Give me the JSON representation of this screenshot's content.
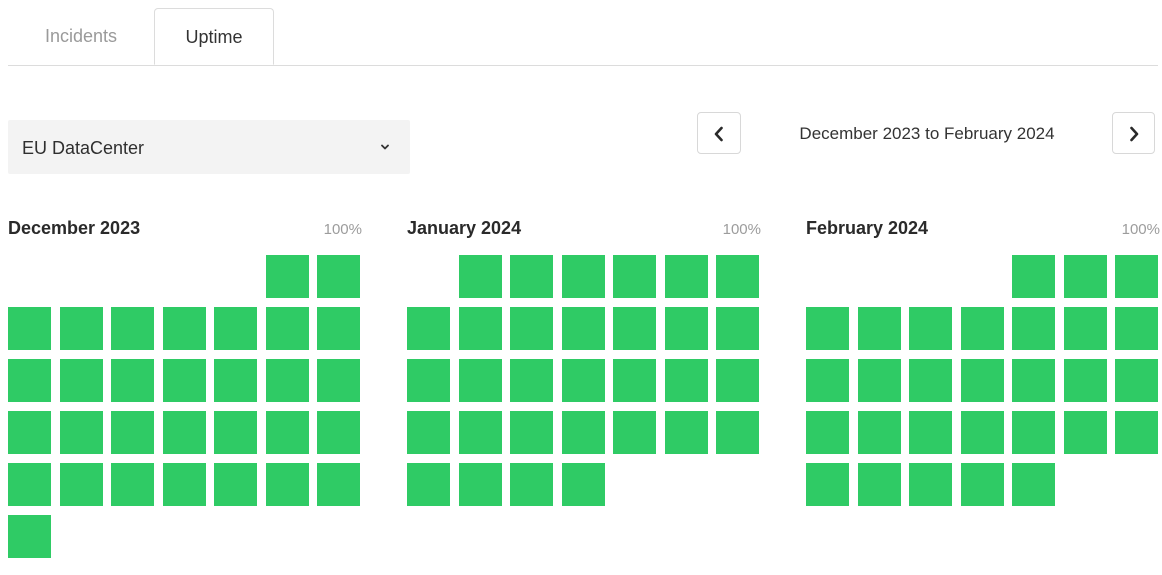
{
  "tabs": {
    "incidents": "Incidents",
    "uptime": "Uptime"
  },
  "region": {
    "selected": "EU DataCenter"
  },
  "range": {
    "label": "December 2023 to February 2024"
  },
  "colors": {
    "operational": "#2fcb65"
  },
  "months": [
    {
      "title": "December 2023",
      "percent": "100%",
      "offset": 5,
      "days": 31
    },
    {
      "title": "January 2024",
      "percent": "100%",
      "offset": 1,
      "days": 31
    },
    {
      "title": "February 2024",
      "percent": "100%",
      "offset": 4,
      "days": 29
    }
  ]
}
